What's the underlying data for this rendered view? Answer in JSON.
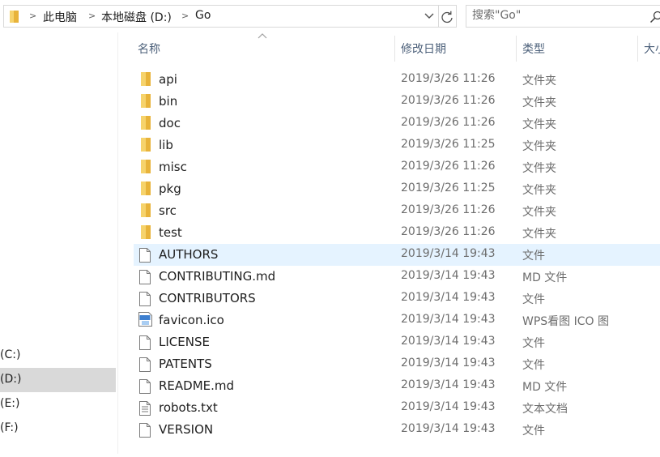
{
  "address_bar": {
    "breadcrumbs": [
      "此电脑",
      "本地磁盘 (D:)",
      "Go"
    ]
  },
  "search": {
    "placeholder": "搜索\"Go\""
  },
  "nav_pane": {
    "drives": [
      {
        "label": "(C:)",
        "selected": false
      },
      {
        "label": "(D:)",
        "selected": true
      },
      {
        "label": "(E:)",
        "selected": false
      },
      {
        "label": "(F:)",
        "selected": false
      }
    ]
  },
  "columns": {
    "name": "名称",
    "date": "修改日期",
    "type": "类型",
    "size": "大小"
  },
  "files": [
    {
      "name": "api",
      "date": "2019/3/26 11:26",
      "type": "文件夹",
      "icon": "folder-icon"
    },
    {
      "name": "bin",
      "date": "2019/3/26 11:26",
      "type": "文件夹",
      "icon": "folder-icon"
    },
    {
      "name": "doc",
      "date": "2019/3/26 11:26",
      "type": "文件夹",
      "icon": "folder-icon"
    },
    {
      "name": "lib",
      "date": "2019/3/26 11:25",
      "type": "文件夹",
      "icon": "folder-icon"
    },
    {
      "name": "misc",
      "date": "2019/3/26 11:26",
      "type": "文件夹",
      "icon": "folder-icon"
    },
    {
      "name": "pkg",
      "date": "2019/3/26 11:25",
      "type": "文件夹",
      "icon": "folder-icon"
    },
    {
      "name": "src",
      "date": "2019/3/26 11:26",
      "type": "文件夹",
      "icon": "folder-icon"
    },
    {
      "name": "test",
      "date": "2019/3/26 11:26",
      "type": "文件夹",
      "icon": "folder-icon"
    },
    {
      "name": "AUTHORS",
      "date": "2019/3/14 19:43",
      "type": "文件",
      "icon": "file-icon"
    },
    {
      "name": "CONTRIBUTING.md",
      "date": "2019/3/14 19:43",
      "type": "MD 文件",
      "icon": "file-icon"
    },
    {
      "name": "CONTRIBUTORS",
      "date": "2019/3/14 19:43",
      "type": "文件",
      "icon": "file-icon"
    },
    {
      "name": "favicon.ico",
      "date": "2019/3/14 19:43",
      "type": "WPS看图 ICO 图",
      "icon": "image-file-icon"
    },
    {
      "name": "LICENSE",
      "date": "2019/3/14 19:43",
      "type": "文件",
      "icon": "file-icon"
    },
    {
      "name": "PATENTS",
      "date": "2019/3/14 19:43",
      "type": "文件",
      "icon": "file-icon"
    },
    {
      "name": "README.md",
      "date": "2019/3/14 19:43",
      "type": "MD 文件",
      "icon": "file-icon"
    },
    {
      "name": "robots.txt",
      "date": "2019/3/14 19:43",
      "type": "文本文档",
      "icon": "text-file-icon"
    },
    {
      "name": "VERSION",
      "date": "2019/3/14 19:43",
      "type": "文件",
      "icon": "file-icon"
    }
  ],
  "hover_row": "AUTHORS",
  "colors": {
    "folder": "#e8b33a",
    "hover_row": "#e5f3ff",
    "selected_drive": "#d9d9d9",
    "header_text": "#4c607a"
  }
}
